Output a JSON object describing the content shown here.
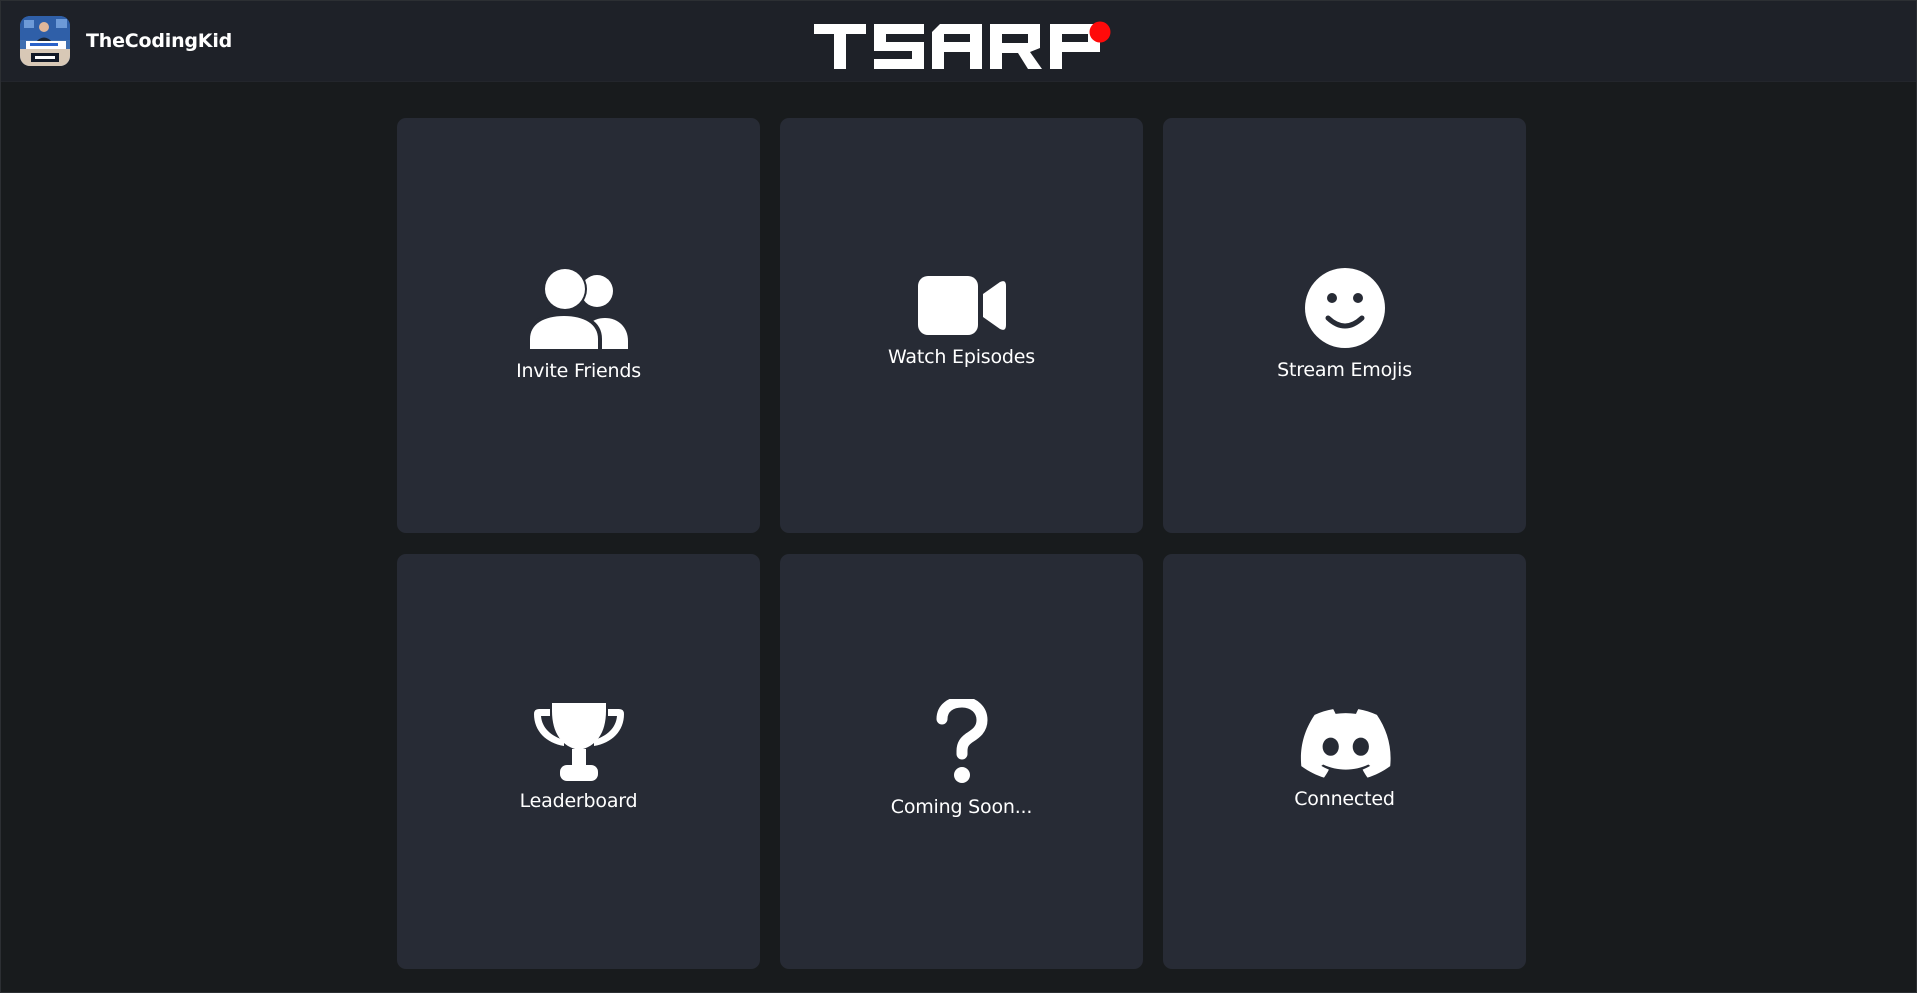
{
  "header": {
    "username": "TheCodingKid",
    "brand": "TSARP",
    "brand_dot_color": "#ff0a0a",
    "avatar_icon": "user-avatar-image"
  },
  "cards": [
    {
      "label": "Invite Friends",
      "icon": "users-icon"
    },
    {
      "label": "Watch Episodes",
      "icon": "video-camera-icon"
    },
    {
      "label": "Stream Emojis",
      "icon": "smiley-face-icon"
    },
    {
      "label": "Leaderboard",
      "icon": "trophy-icon"
    },
    {
      "label": "Coming Soon...",
      "icon": "question-mark-icon"
    },
    {
      "label": "Connected",
      "icon": "discord-icon"
    }
  ],
  "colors": {
    "background": "#181b1d",
    "header": "#1e2128",
    "card": "#272b35",
    "text": "#ffffff"
  }
}
